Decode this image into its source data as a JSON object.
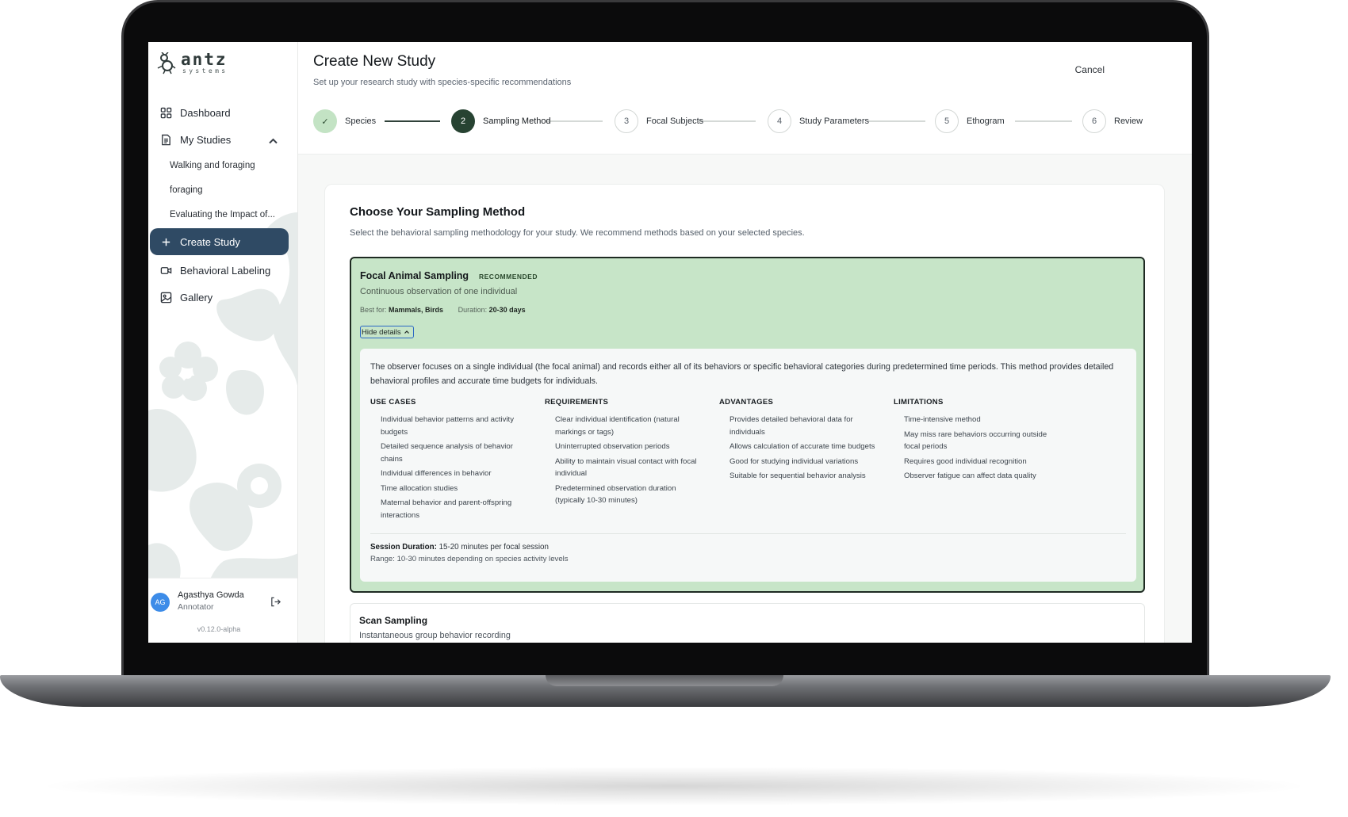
{
  "brand": {
    "name": "antz",
    "sub": "systems"
  },
  "sidebar": {
    "dashboard": "Dashboard",
    "my_studies": "My Studies",
    "studies": [
      "Walking and foraging",
      "foraging",
      "Evaluating the Impact of..."
    ],
    "create_study": "Create Study",
    "behavioral_labeling": "Behavioral Labeling",
    "gallery": "Gallery"
  },
  "user": {
    "initials": "AG",
    "name": "Agasthya Gowda",
    "role": "Annotator",
    "version": "v0.12.0-alpha"
  },
  "header": {
    "title": "Create New Study",
    "subtitle": "Set up your research study with species-specific recommendations",
    "cancel": "Cancel"
  },
  "steps": [
    {
      "num": "✓",
      "label": "Species",
      "state": "done"
    },
    {
      "num": "2",
      "label": "Sampling Method",
      "state": "current"
    },
    {
      "num": "3",
      "label": "Focal Subjects",
      "state": "todo"
    },
    {
      "num": "4",
      "label": "Study Parameters",
      "state": "todo"
    },
    {
      "num": "5",
      "label": "Ethogram",
      "state": "todo"
    },
    {
      "num": "6",
      "label": "Review",
      "state": "todo"
    }
  ],
  "content": {
    "title": "Choose Your Sampling Method",
    "subtitle": "Select the behavioral sampling methodology for your study. We recommend methods based on your selected species."
  },
  "method": {
    "name": "Focal Animal Sampling",
    "badge": "RECOMMENDED",
    "description": "Continuous observation of one individual",
    "best_for_label": "Best for:",
    "best_for": "Mammals, Birds",
    "duration_label": "Duration:",
    "duration": "20-30 days",
    "hide_details": "Hide details",
    "details": "The observer focuses on a single individual (the focal animal) and records either all of its behaviors or specific behavioral categories during predetermined time periods. This method provides detailed behavioral profiles and accurate time budgets for individuals.",
    "use_cases": {
      "title": "USE CASES",
      "items": [
        "Individual behavior patterns and activity budgets",
        "Detailed sequence analysis of behavior chains",
        "Individual differences in behavior",
        "Time allocation studies",
        "Maternal behavior and parent-offspring interactions"
      ]
    },
    "requirements": {
      "title": "REQUIREMENTS",
      "items": [
        "Clear individual identification (natural markings or tags)",
        "Uninterrupted observation periods",
        "Ability to maintain visual contact with focal individual",
        "Predetermined observation duration (typically 10-30 minutes)"
      ]
    },
    "advantages": {
      "title": "ADVANTAGES",
      "items": [
        "Provides detailed behavioral data for individuals",
        "Allows calculation of accurate time budgets",
        "Good for studying individual variations",
        "Suitable for sequential behavior analysis"
      ]
    },
    "limitations": {
      "title": "LIMITATIONS",
      "items": [
        "Time-intensive method",
        "May miss rare behaviors occurring outside focal periods",
        "Requires good individual recognition",
        "Observer fatigue can affect data quality"
      ]
    },
    "session_label": "Session Duration:",
    "session": "15-20 minutes per focal session",
    "range": "Range: 10-30 minutes depending on species activity levels"
  },
  "method2": {
    "name": "Scan Sampling",
    "description": "Instantaneous group behavior recording"
  },
  "colors": {
    "accent_nav": "#2f4a64",
    "recommended_bg": "#c7e5c8",
    "step_current": "#274332",
    "avatar": "#3d8ce8"
  }
}
